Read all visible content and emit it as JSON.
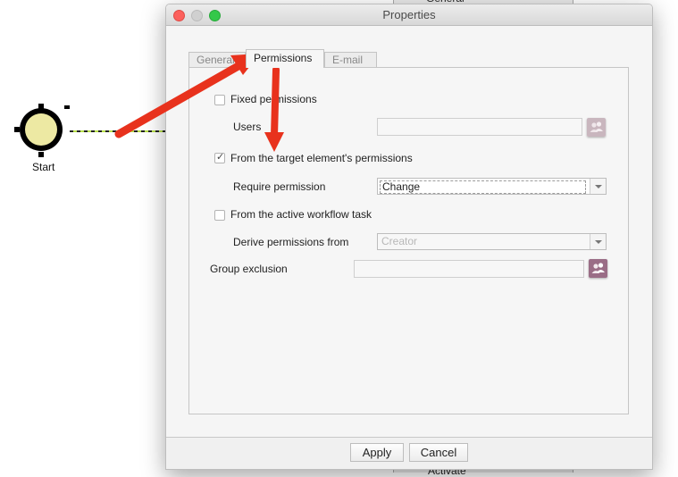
{
  "background": {
    "top_panel_label": "General",
    "bottom_panel_label": "Activate",
    "start_node_label": "Start"
  },
  "dialog": {
    "title": "Properties",
    "tabs": [
      {
        "label": "General",
        "active": false
      },
      {
        "label": "Permissions",
        "active": true
      },
      {
        "label": "E-mail",
        "active": false
      }
    ],
    "fixed_permissions": {
      "label": "Fixed permissions",
      "checked": false
    },
    "users": {
      "label": "Users",
      "value": ""
    },
    "target_element": {
      "label": "From the target element's permissions",
      "checked": true
    },
    "require_permission": {
      "label": "Require permission",
      "value": "Change"
    },
    "active_workflow": {
      "label": "From the active workflow task",
      "checked": false
    },
    "derive_permissions": {
      "label": "Derive permissions from",
      "value": "Creator",
      "disabled": true
    },
    "group_exclusion": {
      "label": "Group exclusion",
      "value": ""
    },
    "buttons": {
      "apply": "Apply",
      "cancel": "Cancel"
    },
    "check_glyph": "✓"
  },
  "colors": {
    "annotation_arrow": "#e8321d",
    "people_button": "#b9a1ac",
    "people_button_active": "#9a6d86",
    "start_fill": "#ede9a3"
  }
}
